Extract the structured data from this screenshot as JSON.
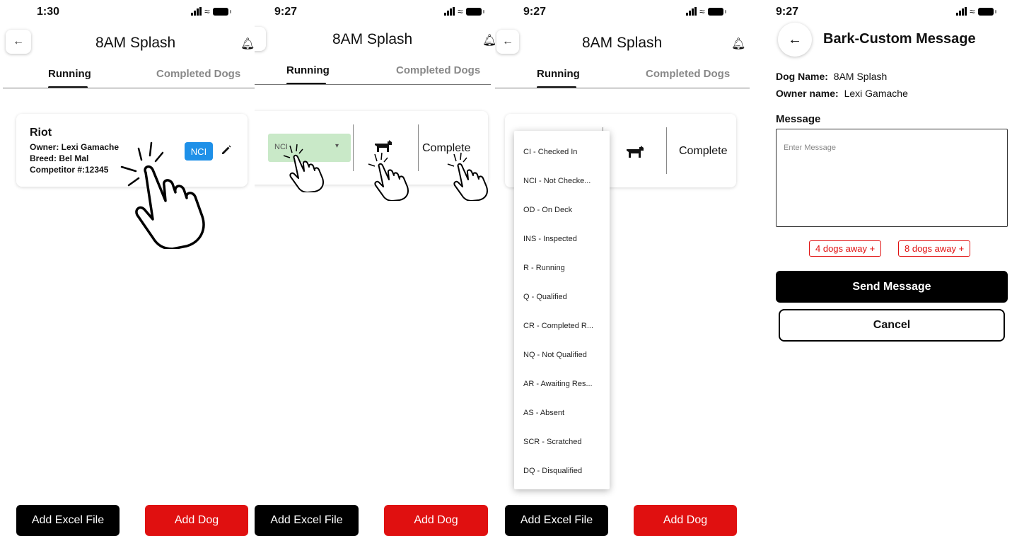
{
  "screens": [
    {
      "time": "1:30",
      "title": "8AM Splash",
      "tabs": [
        "Running",
        "Completed Dogs"
      ],
      "dog_card": {
        "name": "Riot",
        "owner": "Owner: Lexi Gamache",
        "breed": "Breed: Bel Mal",
        "competitor": "Competitor #:12345",
        "status_badge": "NCI"
      },
      "buttons": {
        "add_excel": "Add Excel File",
        "add_dog": "Add Dog"
      }
    },
    {
      "time": "9:27",
      "title": "8AM Splash",
      "tabs": [
        "Running",
        "Completed Dogs"
      ],
      "status_select_value": "NCI",
      "complete_label": "Complete",
      "buttons": {
        "add_excel": "Add Excel File",
        "add_dog": "Add Dog"
      }
    },
    {
      "time": "9:27",
      "title": "8AM Splash",
      "tabs": [
        "Running",
        "Completed Dogs"
      ],
      "complete_label": "Complete",
      "status_options": [
        "CI - Checked In",
        "NCI - Not Checke...",
        "OD - On Deck",
        "INS - Inspected",
        "R - Running",
        "Q - Qualified",
        "CR - Completed R...",
        "NQ - Not Qualified",
        "AR - Awaiting Res...",
        "AS - Absent",
        "SCR - Scratched",
        "DQ - Disqualified"
      ],
      "buttons": {
        "add_excel": "Add Excel File",
        "add_dog": "Add Dog"
      }
    },
    {
      "time": "9:27",
      "title": "Bark-Custom Message",
      "dog_name_label": "Dog Name:",
      "dog_name_value": "8AM Splash",
      "owner_name_label": "Owner name:",
      "owner_name_value": "Lexi Gamache",
      "message_label": "Message",
      "message_placeholder": "Enter Message",
      "quick_chips": [
        "4 dogs away +",
        "8 dogs away +"
      ],
      "send_label": "Send Message",
      "cancel_label": "Cancel"
    }
  ],
  "colors": {
    "badge_blue": "#1e90e8",
    "select_green": "#c9e9c8",
    "danger_red": "#e01010",
    "black": "#000000"
  },
  "icons": [
    "back-arrow-icon",
    "bell-icon",
    "pencil-icon",
    "dog-icon",
    "dropdown-caret-icon",
    "signal-icon",
    "wifi-icon",
    "battery-icon",
    "tap-hand-icon"
  ]
}
